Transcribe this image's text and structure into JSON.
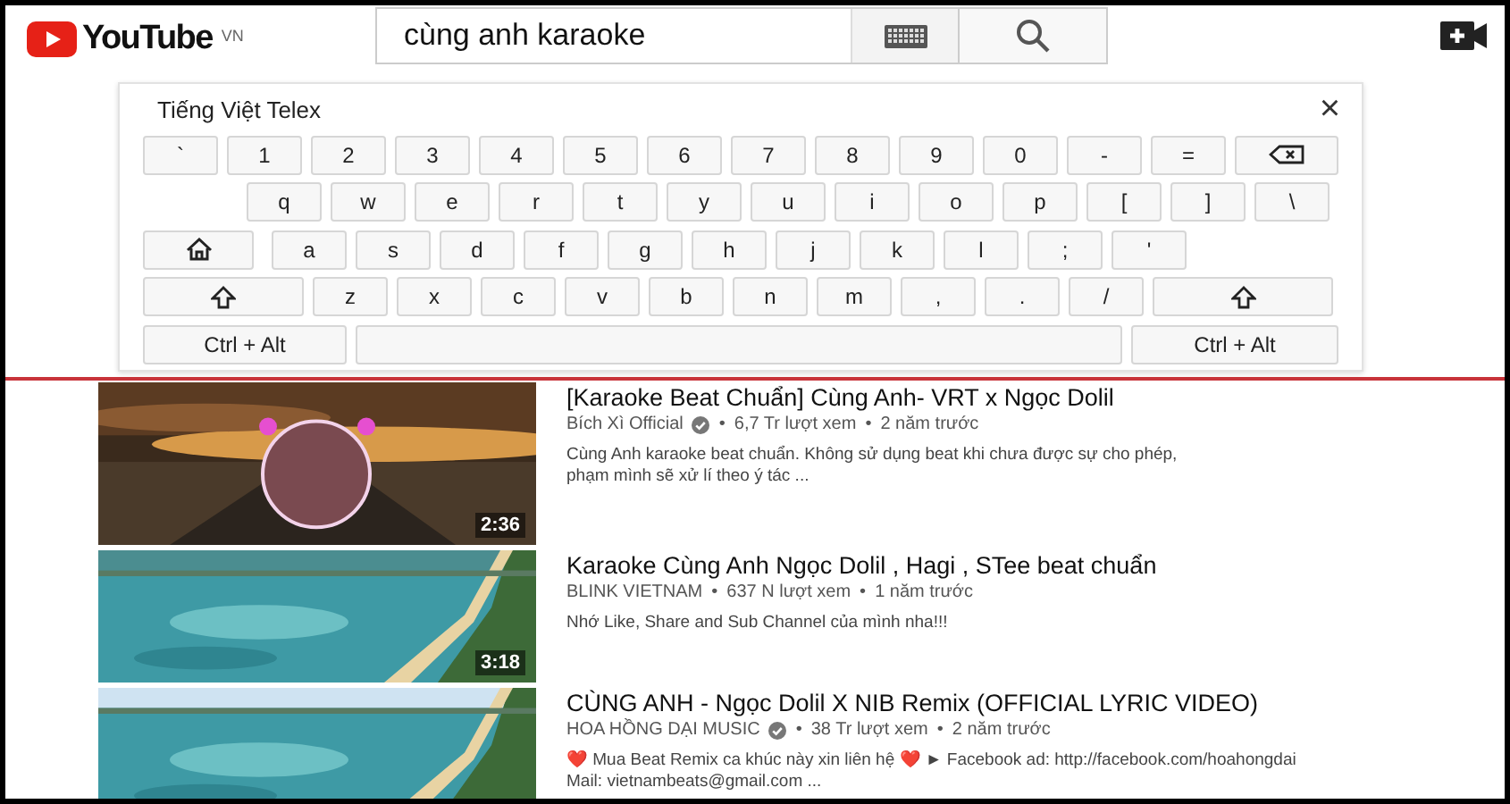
{
  "header": {
    "logo": "YouTube",
    "region": "VN",
    "search": {
      "value": "cùng anh karaoke"
    }
  },
  "keyboard": {
    "title": "Tiếng Việt Telex",
    "close": "×",
    "rows": [
      {
        "keys": [
          {
            "kind": "char",
            "label": "`"
          },
          {
            "kind": "char",
            "label": "1"
          },
          {
            "kind": "char",
            "label": "2"
          },
          {
            "kind": "char",
            "label": "3"
          },
          {
            "kind": "char",
            "label": "4"
          },
          {
            "kind": "char",
            "label": "5"
          },
          {
            "kind": "char",
            "label": "6"
          },
          {
            "kind": "char",
            "label": "7"
          },
          {
            "kind": "char",
            "label": "8"
          },
          {
            "kind": "char",
            "label": "9"
          },
          {
            "kind": "char",
            "label": "0"
          },
          {
            "kind": "char",
            "label": "-"
          },
          {
            "kind": "char",
            "label": "="
          },
          {
            "kind": "backspace"
          }
        ]
      },
      {
        "keys": [
          {
            "kind": "indent"
          },
          {
            "kind": "char",
            "label": "q"
          },
          {
            "kind": "char",
            "label": "w"
          },
          {
            "kind": "char",
            "label": "e"
          },
          {
            "kind": "char",
            "label": "r"
          },
          {
            "kind": "char",
            "label": "t"
          },
          {
            "kind": "char",
            "label": "y"
          },
          {
            "kind": "char",
            "label": "u"
          },
          {
            "kind": "char",
            "label": "i"
          },
          {
            "kind": "char",
            "label": "o"
          },
          {
            "kind": "char",
            "label": "p"
          },
          {
            "kind": "char",
            "label": "["
          },
          {
            "kind": "char",
            "label": "]"
          },
          {
            "kind": "char",
            "label": "\\"
          }
        ]
      },
      {
        "keys": [
          {
            "kind": "home"
          },
          {
            "kind": "char",
            "label": "a"
          },
          {
            "kind": "char",
            "label": "s"
          },
          {
            "kind": "char",
            "label": "d"
          },
          {
            "kind": "char",
            "label": "f"
          },
          {
            "kind": "char",
            "label": "g"
          },
          {
            "kind": "char",
            "label": "h"
          },
          {
            "kind": "char",
            "label": "j"
          },
          {
            "kind": "char",
            "label": "k"
          },
          {
            "kind": "char",
            "label": "l"
          },
          {
            "kind": "char",
            "label": ";"
          },
          {
            "kind": "char",
            "label": "'"
          }
        ]
      },
      {
        "keys": [
          {
            "kind": "shift"
          },
          {
            "kind": "char",
            "label": "z"
          },
          {
            "kind": "char",
            "label": "x"
          },
          {
            "kind": "char",
            "label": "c"
          },
          {
            "kind": "char",
            "label": "v"
          },
          {
            "kind": "char",
            "label": "b"
          },
          {
            "kind": "char",
            "label": "n"
          },
          {
            "kind": "char",
            "label": "m"
          },
          {
            "kind": "char",
            "label": ","
          },
          {
            "kind": "char",
            "label": "."
          },
          {
            "kind": "char",
            "label": "/"
          },
          {
            "kind": "shift"
          }
        ]
      },
      {
        "keys": [
          {
            "kind": "ctrl",
            "label": "Ctrl + Alt"
          },
          {
            "kind": "space"
          },
          {
            "kind": "ctrl",
            "label": "Ctrl + Alt"
          }
        ]
      }
    ]
  },
  "results": [
    {
      "title": "[Karaoke Beat Chuẩn] Cùng Anh- VRT x Ngọc Dolil",
      "channel": "Bích Xì Official",
      "verified": true,
      "views": "6,7 Tr lượt xem",
      "separators": [
        "•",
        "•"
      ],
      "age": "2 năm trước",
      "description": [
        "Cùng Anh karaoke beat chuẩn. Không sử dụng beat khi chưa được sự cho phép,",
        "phạm mình sẽ xử lí theo ý tác ..."
      ],
      "duration": "2:36"
    },
    {
      "title": "Karaoke Cùng Anh Ngọc Dolil , Hagi , STee beat chuẩn",
      "channel": "BLINK VIETNAM",
      "verified": false,
      "views": "637 N lượt xem",
      "separators": [
        "•",
        "•"
      ],
      "age": "1 năm trước",
      "description": [
        "Nhớ Like, Share and Sub Channel của mình nha!!!"
      ],
      "duration": "3:18"
    },
    {
      "title": "CÙNG ANH - Ngọc Dolil X NIB Remix (OFFICIAL LYRIC VIDEO)",
      "channel": "HOA HỒNG DẠI MUSIC",
      "verified": true,
      "views": "38 Tr lượt xem",
      "separators": [
        "•",
        "•"
      ],
      "age": "2 năm trước",
      "description": [
        "❤️ Mua Beat Remix ca khúc này xin liên hệ ❤️ ► Facebook ad: http://facebook.com/hoahongdai",
        "Mail: vietnambeats@gmail.com ..."
      ]
    }
  ]
}
